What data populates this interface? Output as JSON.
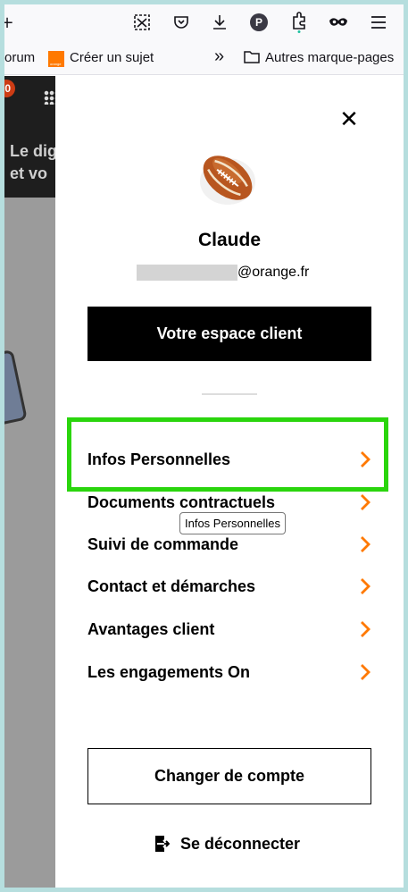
{
  "browser": {
    "toolbar_icons": [
      "plus-icon",
      "screenshot-icon",
      "pocket-icon",
      "download-icon",
      "profile-icon",
      "extensions-icon",
      "private-mask-icon",
      "hamburger-menu-icon"
    ],
    "profile_letter": "P",
    "bookmarks": {
      "item1_label": "orum",
      "item2_label": "Créer un sujet",
      "orange_logo_text": "orange",
      "overflow_label": "»",
      "folder_label": "Autres marque-pages"
    }
  },
  "background_page": {
    "badge_count": "0",
    "headline_line1": "Le dig",
    "headline_line2": "et vo"
  },
  "account_menu": {
    "close_label": "✕",
    "user_name": "Claude",
    "email_suffix": "@orange.fr",
    "primary_button": "Votre espace client",
    "items": [
      {
        "label": "Infos Personnelles"
      },
      {
        "label": "Documents contractuels"
      },
      {
        "label": "Suivi de commande"
      },
      {
        "label": "Contact et démarches"
      },
      {
        "label": "Avantages client"
      },
      {
        "label": "Les engagements On"
      }
    ],
    "tooltip": "Infos Personnelles",
    "switch_account_button": "Changer de compte",
    "logout_label": "Se déconnecter"
  },
  "colors": {
    "accent_orange": "#ff7900",
    "highlight_green": "#2ad50d",
    "overlay_grey": "#9b9b9b"
  }
}
